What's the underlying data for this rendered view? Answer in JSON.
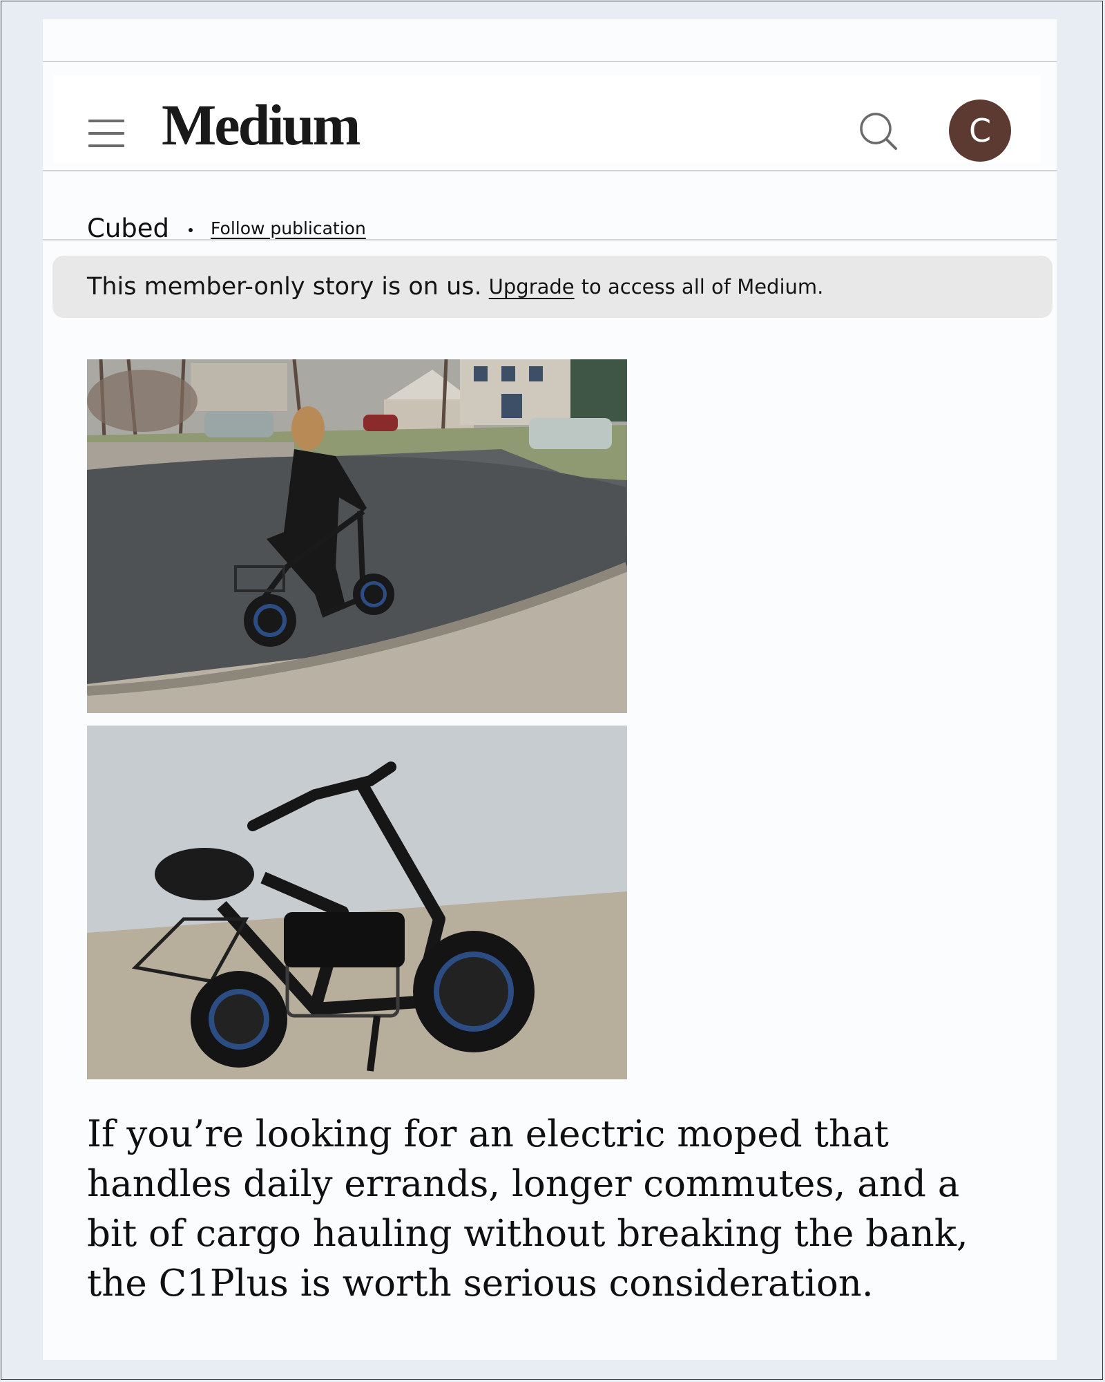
{
  "header": {
    "menu_icon": "hamburger-menu-icon",
    "logo": "Medium",
    "search_icon": "search-icon",
    "avatar_initial": "C",
    "avatar_color": "#5c3a32"
  },
  "publication": {
    "name": "Cubed",
    "follow_label": "Follow publication"
  },
  "banner": {
    "lead": "This member-only story is on us.",
    "link": "Upgrade",
    "rest": "to access all of Medium."
  },
  "images": [
    {
      "icon": "photo-woman-riding-moped"
    },
    {
      "icon": "photo-c1plus-electric-moped"
    }
  ],
  "article": {
    "paragraph": "If you’re looking for an electric moped that handles daily errands, longer commutes, and a bit of cargo hauling without breaking the bank, the C1Plus is worth serious consideration."
  }
}
